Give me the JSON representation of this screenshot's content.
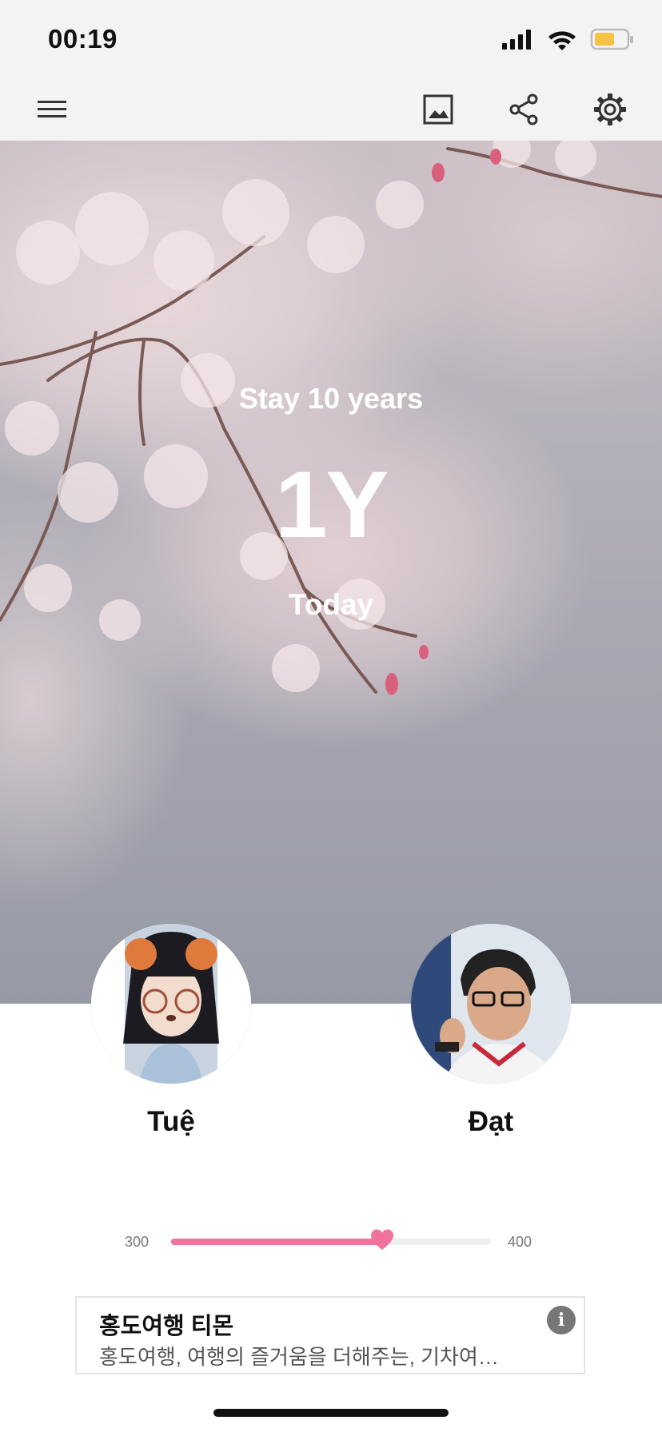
{
  "status_bar": {
    "time": "00:19",
    "icons": [
      "signal-icon",
      "wifi-icon",
      "battery-icon"
    ],
    "battery_color": "#f5c242"
  },
  "toolbar": {
    "icons": [
      "menu-icon",
      "image-icon",
      "share-icon",
      "settings-icon"
    ]
  },
  "hero": {
    "subtitle": "Stay 10 years",
    "duration": "1Y",
    "date_label": "Today"
  },
  "couple": {
    "left_name": "Tuệ",
    "right_name": "Đạt"
  },
  "progress": {
    "min_label": "300",
    "max_label": "400",
    "fraction": 0.66,
    "accent_color": "#f0739b"
  },
  "ad": {
    "title": "홍도여행 티몬",
    "description": "홍도여행, 여행의 즐거움을 더해주는, 기차여…",
    "info_icon": "i"
  }
}
